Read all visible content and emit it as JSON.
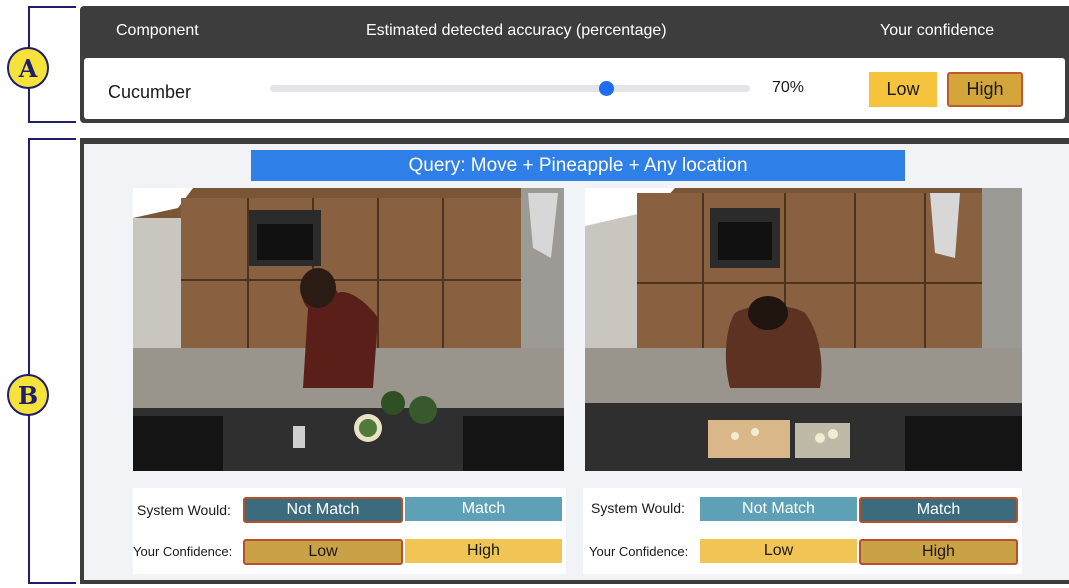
{
  "section_labels": {
    "a": "A",
    "b": "B"
  },
  "panel_a": {
    "headers": {
      "component": "Component",
      "accuracy": "Estimated detected accuracy (percentage)",
      "confidence": "Your confidence"
    },
    "row": {
      "component": "Cucumber",
      "accuracy_value": 70,
      "accuracy_label": "70%",
      "confidence_low": "Low",
      "confidence_high": "High",
      "selected_confidence": "High"
    }
  },
  "panel_b": {
    "query": "Query:  Move + Pineapple + Any location",
    "items": [
      {
        "system_label": "System Would:",
        "not_match": "Not Match",
        "match": "Match",
        "system_selected": "Not Match",
        "confidence_label": "Your Confidence:",
        "low": "Low",
        "high": "High",
        "confidence_selected": "Low"
      },
      {
        "system_label": "System Would:",
        "not_match": "Not Match",
        "match": "Match",
        "system_selected": "Match",
        "confidence_label": "Your Confidence:",
        "low": "Low",
        "high": "High",
        "confidence_selected": "High"
      }
    ]
  },
  "colors": {
    "panel_bg": "#3d3d3d",
    "query_bar": "#2f7fe8",
    "slider_thumb": "#1f6cf0",
    "selected_outline": "#b5502b",
    "low_yellow": "#f5c33c",
    "high_gold": "#d3a53a",
    "teal_dark": "#3d6b7e",
    "teal_light": "#5ea0b5",
    "section_circle": "#f5e23b"
  }
}
